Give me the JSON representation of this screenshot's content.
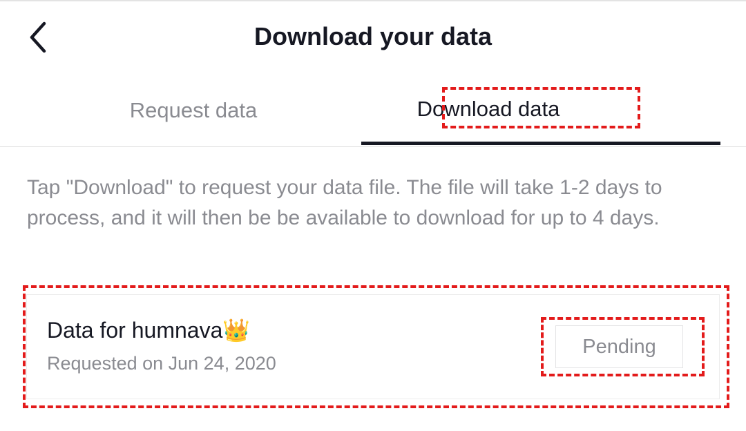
{
  "header": {
    "title": "Download your data",
    "back_icon": "chevron-left-icon"
  },
  "tabs": [
    {
      "label": "Request data",
      "active": false
    },
    {
      "label": "Download data",
      "active": true
    }
  ],
  "description": "Tap \"Download\" to request your data file. The file will take 1-2 days to process, and it will then be be available to download for up to 4 days.",
  "card": {
    "title": "Data for humnava👑",
    "subtitle": "Requested on Jun 24, 2020",
    "status_button": "Pending"
  },
  "colors": {
    "text_primary": "#161823",
    "text_secondary": "#8a8b91",
    "highlight": "#e31b1b"
  }
}
